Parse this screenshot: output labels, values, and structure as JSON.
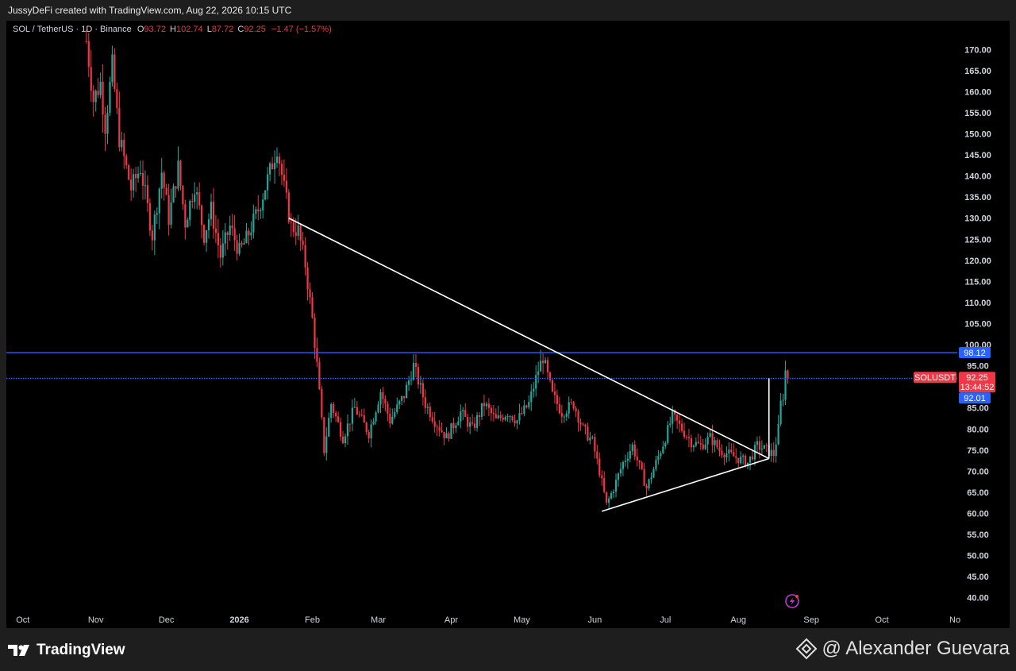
{
  "header": {
    "credit": "JussyDeFi created with TradingView.com, Aug 22, 2026 10:15 UTC"
  },
  "legend": {
    "symbol": "SOL / TetherUS · 1D · Binance",
    "open_label": "O",
    "open": "93.72",
    "high_label": "H",
    "high": "102.74",
    "low_label": "L",
    "low": "87.72",
    "close_label": "C",
    "close": "92.25",
    "change": "−1.47 (−1.57%)"
  },
  "chart_data": {
    "type": "candlestick",
    "y_axis": {
      "range": [
        37.5,
        172.5
      ],
      "ticks": [
        "170.00",
        "165.00",
        "160.00",
        "155.00",
        "150.00",
        "145.00",
        "140.00",
        "135.00",
        "130.00",
        "125.00",
        "120.00",
        "115.00",
        "110.00",
        "105.00",
        "100.00",
        "95.00",
        "90.00",
        "85.00",
        "80.00",
        "75.00",
        "70.00",
        "65.00",
        "60.00",
        "55.00",
        "50.00",
        "45.00",
        "40.00"
      ],
      "tick_values": [
        170,
        165,
        160,
        155,
        150,
        145,
        140,
        135,
        130,
        125,
        120,
        115,
        110,
        105,
        100,
        95,
        90,
        85,
        80,
        75,
        70,
        65,
        60,
        55,
        50,
        45,
        40
      ]
    },
    "x_axis": {
      "range": [
        "2025-09-24",
        "2026-11-02"
      ],
      "ticks": [
        {
          "label": "Oct",
          "date": "2025-10-01",
          "bold": false
        },
        {
          "label": "Nov",
          "date": "2025-11-01",
          "bold": false
        },
        {
          "label": "Dec",
          "date": "2025-12-01",
          "bold": false
        },
        {
          "label": "2026",
          "date": "2026-01-01",
          "bold": true
        },
        {
          "label": "Feb",
          "date": "2026-02-01",
          "bold": false
        },
        {
          "label": "Mar",
          "date": "2026-03-01",
          "bold": false
        },
        {
          "label": "Apr",
          "date": "2026-04-01",
          "bold": false
        },
        {
          "label": "May",
          "date": "2026-05-01",
          "bold": false
        },
        {
          "label": "Jun",
          "date": "2026-06-01",
          "bold": false
        },
        {
          "label": "Jul",
          "date": "2026-07-01",
          "bold": false
        },
        {
          "label": "Aug",
          "date": "2026-08-01",
          "bold": false
        },
        {
          "label": "Sep",
          "date": "2026-09-01",
          "bold": false
        },
        {
          "label": "Oct",
          "date": "2026-10-01",
          "bold": false
        },
        {
          "label": "No",
          "date": "2026-11-01",
          "bold": false
        }
      ]
    },
    "price_path": [
      {
        "date": "2025-10-28",
        "close": 172
      },
      {
        "date": "2025-10-31",
        "close": 158
      },
      {
        "date": "2025-11-03",
        "close": 162
      },
      {
        "date": "2025-11-05",
        "close": 152
      },
      {
        "date": "2025-11-08",
        "close": 166
      },
      {
        "date": "2025-11-11",
        "close": 149
      },
      {
        "date": "2025-11-16",
        "close": 137
      },
      {
        "date": "2025-11-20",
        "close": 142
      },
      {
        "date": "2025-11-25",
        "close": 126
      },
      {
        "date": "2025-11-29",
        "close": 141
      },
      {
        "date": "2025-12-02",
        "close": 130
      },
      {
        "date": "2025-12-06",
        "close": 142
      },
      {
        "date": "2025-12-09",
        "close": 129
      },
      {
        "date": "2025-12-13",
        "close": 138
      },
      {
        "date": "2025-12-17",
        "close": 126
      },
      {
        "date": "2025-12-20",
        "close": 132
      },
      {
        "date": "2025-12-24",
        "close": 121
      },
      {
        "date": "2025-12-28",
        "close": 128
      },
      {
        "date": "2026-01-01",
        "close": 122
      },
      {
        "date": "2026-01-04",
        "close": 125
      },
      {
        "date": "2026-01-09",
        "close": 132
      },
      {
        "date": "2026-01-14",
        "close": 141
      },
      {
        "date": "2026-01-17",
        "close": 147
      },
      {
        "date": "2026-01-20",
        "close": 137
      },
      {
        "date": "2026-01-23",
        "close": 128
      },
      {
        "date": "2026-01-26",
        "close": 127
      },
      {
        "date": "2026-01-29",
        "close": 119
      },
      {
        "date": "2026-02-01",
        "close": 106
      },
      {
        "date": "2026-02-03",
        "close": 95
      },
      {
        "date": "2026-02-06",
        "close": 75
      },
      {
        "date": "2026-02-09",
        "close": 86
      },
      {
        "date": "2026-02-14",
        "close": 78
      },
      {
        "date": "2026-02-19",
        "close": 85
      },
      {
        "date": "2026-02-25",
        "close": 79
      },
      {
        "date": "2026-03-02",
        "close": 89
      },
      {
        "date": "2026-03-06",
        "close": 82
      },
      {
        "date": "2026-03-12",
        "close": 88
      },
      {
        "date": "2026-03-16",
        "close": 95
      },
      {
        "date": "2026-03-21",
        "close": 86
      },
      {
        "date": "2026-03-25",
        "close": 82
      },
      {
        "date": "2026-03-30",
        "close": 78
      },
      {
        "date": "2026-04-05",
        "close": 84
      },
      {
        "date": "2026-04-10",
        "close": 80
      },
      {
        "date": "2026-04-15",
        "close": 86
      },
      {
        "date": "2026-04-20",
        "close": 82
      },
      {
        "date": "2026-04-25",
        "close": 84
      },
      {
        "date": "2026-04-29",
        "close": 82
      },
      {
        "date": "2026-05-04",
        "close": 86
      },
      {
        "date": "2026-05-08",
        "close": 94
      },
      {
        "date": "2026-05-10",
        "close": 97
      },
      {
        "date": "2026-05-14",
        "close": 88
      },
      {
        "date": "2026-05-18",
        "close": 84
      },
      {
        "date": "2026-05-23",
        "close": 86
      },
      {
        "date": "2026-05-27",
        "close": 80
      },
      {
        "date": "2026-05-31",
        "close": 77
      },
      {
        "date": "2026-06-03",
        "close": 70
      },
      {
        "date": "2026-06-06",
        "close": 62
      },
      {
        "date": "2026-06-09",
        "close": 66
      },
      {
        "date": "2026-06-13",
        "close": 72
      },
      {
        "date": "2026-06-17",
        "close": 76
      },
      {
        "date": "2026-06-20",
        "close": 71
      },
      {
        "date": "2026-06-23",
        "close": 66
      },
      {
        "date": "2026-06-27",
        "close": 72
      },
      {
        "date": "2026-07-01",
        "close": 78
      },
      {
        "date": "2026-07-04",
        "close": 83
      },
      {
        "date": "2026-07-08",
        "close": 80
      },
      {
        "date": "2026-07-12",
        "close": 77
      },
      {
        "date": "2026-07-16",
        "close": 76
      },
      {
        "date": "2026-07-20",
        "close": 78
      },
      {
        "date": "2026-07-24",
        "close": 75
      },
      {
        "date": "2026-07-28",
        "close": 74
      },
      {
        "date": "2026-08-01",
        "close": 73
      },
      {
        "date": "2026-08-05",
        "close": 72
      },
      {
        "date": "2026-08-09",
        "close": 76
      },
      {
        "date": "2026-08-13",
        "close": 75
      },
      {
        "date": "2026-08-16",
        "close": 74
      },
      {
        "date": "2026-08-18",
        "close": 80
      },
      {
        "date": "2026-08-19",
        "close": 86
      },
      {
        "date": "2026-08-20",
        "close": 88
      },
      {
        "date": "2026-08-21",
        "close": 93.72
      },
      {
        "date": "2026-08-22",
        "close": 92.25
      }
    ],
    "horizontal_lines": [
      {
        "price": 98.12,
        "color": "#2962ff",
        "style": "solid",
        "label": "98.12"
      },
      {
        "price": 92.01,
        "color": "#2962ff",
        "style": "dotted",
        "label": "92.01"
      }
    ],
    "trendlines": [
      {
        "from": {
          "date": "2026-01-22",
          "price": 130
        },
        "to": {
          "date": "2026-08-14",
          "price": 73
        }
      },
      {
        "from": {
          "date": "2026-06-04",
          "price": 60.5
        },
        "to": {
          "date": "2026-08-14",
          "price": 73
        }
      },
      {
        "from": {
          "date": "2026-08-14",
          "price": 73
        },
        "to": {
          "date": "2026-08-14",
          "price": 92
        }
      }
    ],
    "last_price_badge": {
      "symbol": "SOLUSDT",
      "price": "92.25",
      "countdown": "13:44:52",
      "color": "#f23645"
    },
    "colors": {
      "up": "#26a69a",
      "down": "#f23645",
      "background": "#000000"
    }
  },
  "footer": {
    "brand": "TradingView",
    "author": "@ Alexander Guevara"
  }
}
